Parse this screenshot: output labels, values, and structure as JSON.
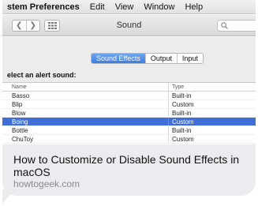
{
  "menubar": {
    "app": "stem Preferences",
    "items": [
      "Edit",
      "View",
      "Window",
      "Help"
    ]
  },
  "toolbar": {
    "back_icon": "chevron-left",
    "forward_icon": "chevron-right",
    "show_all_icon": "grid",
    "title": "Sound",
    "search_icon": "magnifier"
  },
  "tabs": [
    {
      "label": "Sound Effects",
      "selected": true
    },
    {
      "label": "Output",
      "selected": false
    },
    {
      "label": "Input",
      "selected": false
    }
  ],
  "prompt": "elect an alert sound:",
  "table": {
    "columns": [
      "Name",
      "Type"
    ],
    "rows": [
      {
        "name": "Basso",
        "type": "Built-in",
        "selected": false
      },
      {
        "name": "Blip",
        "type": "Custom",
        "selected": false
      },
      {
        "name": "Blow",
        "type": "Built-in",
        "selected": false
      },
      {
        "name": "Boing",
        "type": "Custom",
        "selected": true
      },
      {
        "name": "Bottle",
        "type": "Built-in",
        "selected": false
      },
      {
        "name": "ChuToy",
        "type": "Custom",
        "selected": false
      }
    ]
  },
  "caption": {
    "title": "How to Customize or Disable Sound Effects in macOS",
    "domain": "howtogeek.com"
  },
  "colors": {
    "selection": "#3f6ed6",
    "tab_selected": "#3b7ee0",
    "bubble": "#ececee"
  }
}
